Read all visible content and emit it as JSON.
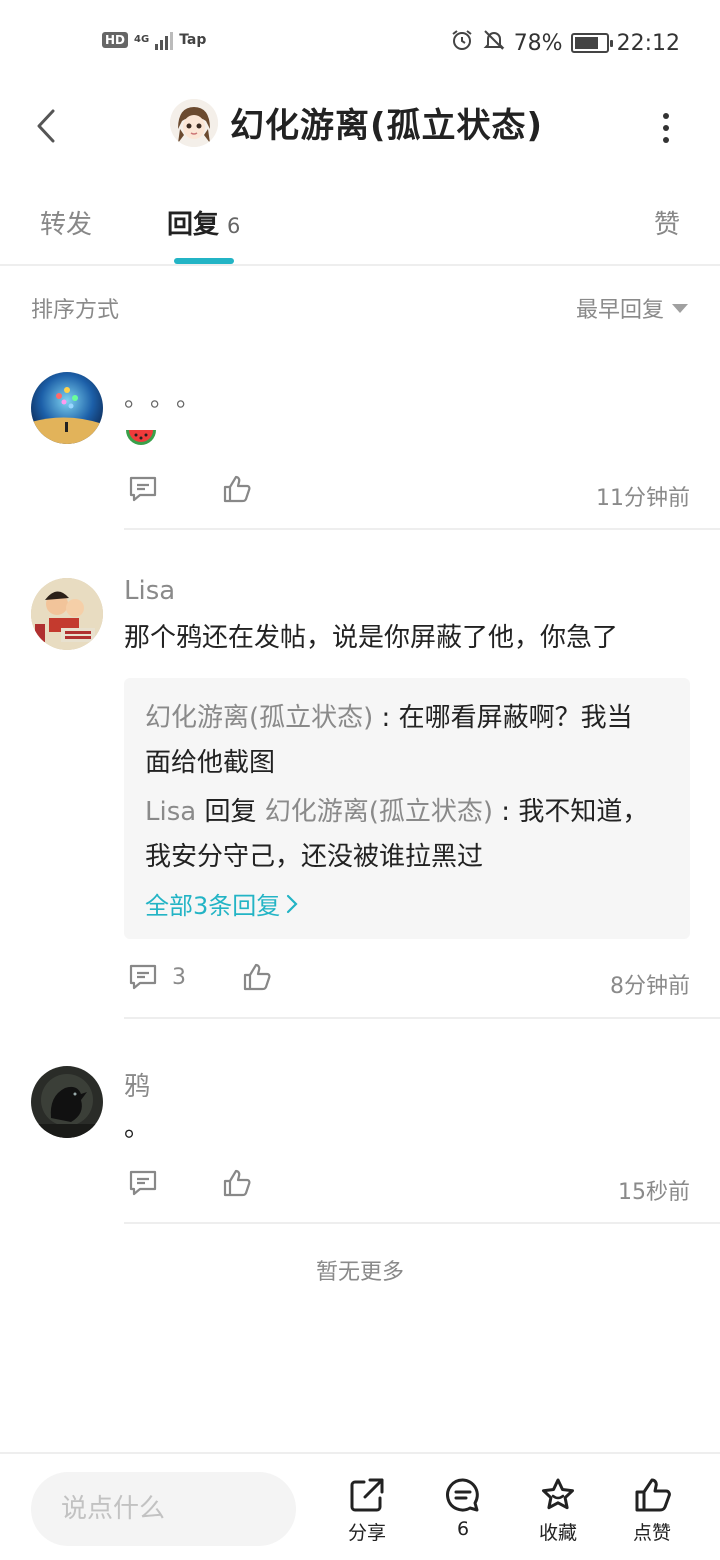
{
  "status_bar": {
    "hd": "HD",
    "network": "4G",
    "app_hint": "Tap",
    "battery_percent": "78%",
    "battery_level": 0.78,
    "time": "22:12"
  },
  "header": {
    "title": "幻化游离(孤立状态)"
  },
  "tabs": {
    "forward": "转发",
    "reply": "回复",
    "reply_count": "6",
    "like": "赞"
  },
  "sort": {
    "label": "排序方式",
    "selected": "最早回复"
  },
  "comments": [
    {
      "name": "",
      "text": "。。。",
      "time": "11分钟前",
      "reply_count": ""
    },
    {
      "name": "Lisa",
      "text": "那个鸦还在发帖，说是你屏蔽了他，你急了",
      "replies": [
        {
          "user": "幻化游离(孤立状态)",
          "sep": " : ",
          "text_line1": "在哪看屏蔽啊？我当",
          "text_line2": "面给他截图"
        },
        {
          "user": "Lisa",
          "reply_word": " 回复 ",
          "target": "幻化游离(孤立状态)",
          "sep": " : ",
          "text_line1": "我不知道，",
          "text_line2": "我安分守己，还没被谁拉黑过"
        }
      ],
      "more_replies": "全部3条回复",
      "reply_count": "3",
      "time": "8分钟前"
    },
    {
      "name": "鸦",
      "text": "。",
      "time": "15秒前",
      "reply_count": ""
    }
  ],
  "no_more": "暂无更多",
  "bottom_bar": {
    "input_placeholder": "说点什么",
    "share": "分享",
    "comments": "6",
    "favorite": "收藏",
    "like": "点赞"
  },
  "colors": {
    "accent": "#23b4c5",
    "text": "#222222",
    "muted": "#8a8a8a"
  }
}
